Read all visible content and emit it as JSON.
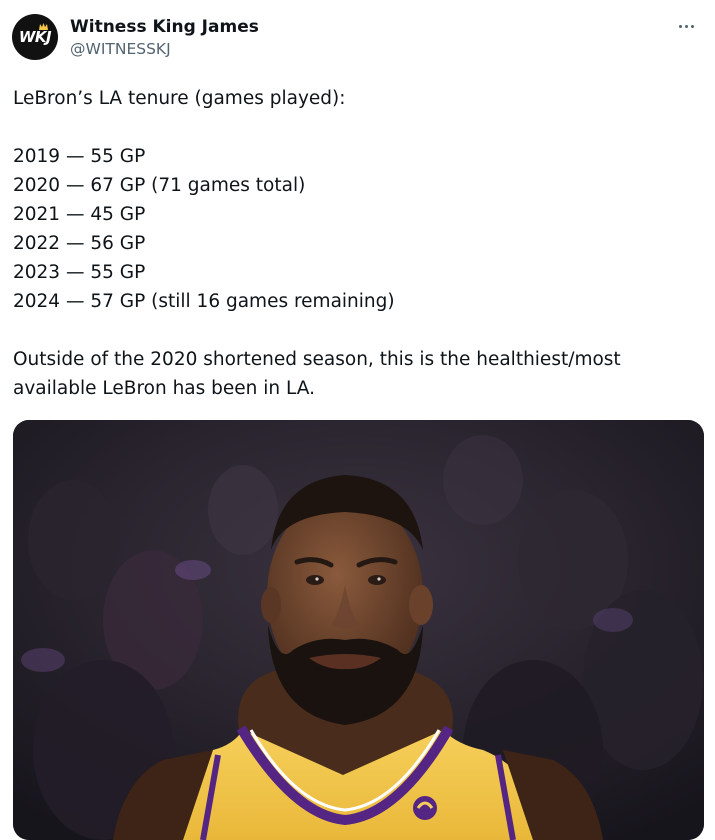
{
  "author": {
    "avatar_text": "WKJ",
    "display_name": "Witness King James",
    "handle": "@WITNESSKJ"
  },
  "tweet": {
    "intro": "LeBron’s LA tenure (games played):",
    "seasons": [
      "2019 — 55 GP",
      "2020 — 67 GP (71 games total)",
      "2021 — 45 GP",
      "2022 — 56 GP",
      "2023 — 55 GP",
      "2024 — 57 GP (still 16 games remaining)"
    ],
    "closing": [
      "Outside of the 2020 shortened season, this is the healthiest/most",
      "available LeBron has been in LA."
    ]
  },
  "colors": {
    "text": "#0f1419",
    "secondary": "#536471",
    "jersey_gold": "#f4c64a",
    "jersey_purple": "#552583"
  },
  "icons": {
    "menu": "more-horizontal-icon",
    "avatar_mark": "crown-icon"
  }
}
